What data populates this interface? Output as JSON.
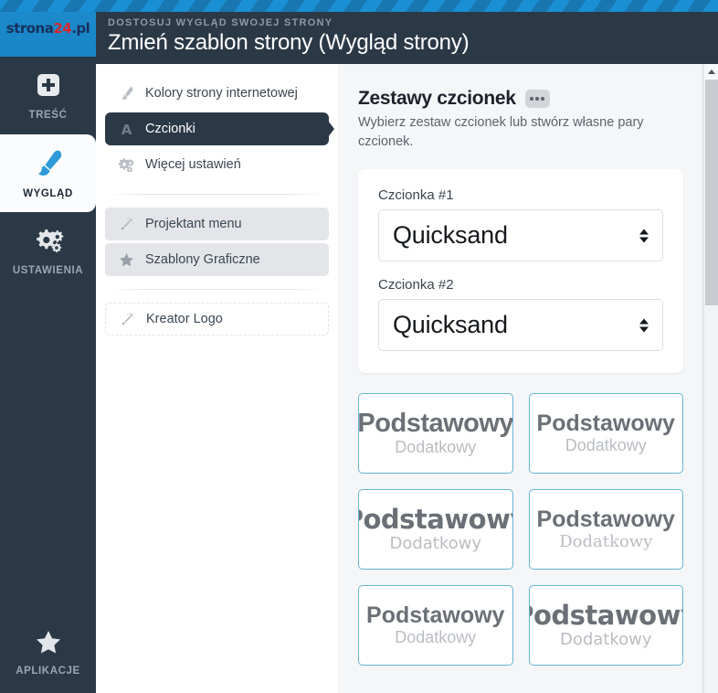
{
  "brand": {
    "logo_part1": "strona",
    "logo_part2": "24",
    "logo_part3": ".pl",
    "accent_blue": "#1b8fd4",
    "dark_navy": "#2b3947",
    "logo_red": "#d8262c"
  },
  "header": {
    "kicker": "DOSTOSUJ WYGLĄD SWOJEJ STRONY",
    "title": "Zmień szablon strony (Wygląd strony)"
  },
  "rail": {
    "items": [
      {
        "label": "TREŚĆ",
        "icon": "plus-square-icon",
        "active": false
      },
      {
        "label": "WYGLĄD",
        "icon": "paintbrush-icon",
        "active": true
      },
      {
        "label": "USTAWIENIA",
        "icon": "gears-icon",
        "active": false
      }
    ],
    "bottom": {
      "label": "APLIKACJE",
      "icon": "star-icon"
    }
  },
  "submenu": {
    "group1": [
      {
        "label": "Kolory strony internetowej",
        "icon": "paintbrush-icon",
        "state": "normal"
      },
      {
        "label": "Czcionki",
        "icon": "letter-a-icon",
        "state": "active"
      },
      {
        "label": "Więcej ustawień",
        "icon": "gears-icon",
        "state": "normal"
      }
    ],
    "group2": [
      {
        "label": "Projektant menu",
        "icon": "magic-wand-icon",
        "state": "soft"
      },
      {
        "label": "Szablony Graficzne",
        "icon": "star-icon",
        "state": "soft"
      }
    ],
    "group3": [
      {
        "label": "Kreator Logo",
        "icon": "magic-wand-icon",
        "state": "outline"
      }
    ]
  },
  "main": {
    "section_title": "Zestawy czcionek",
    "section_badge": "more-options-badge",
    "section_subtitle": "Wybierz zestaw czcionek lub stwórz własne pary czcionek.",
    "picker": {
      "field1_label": "Czcionka #1",
      "field1_value": "Quicksand",
      "field2_label": "Czcionka #2",
      "field2_value": "Quicksand"
    },
    "preview_cards": [
      {
        "primary": "Podstawowy",
        "secondary": "Dodatkowy",
        "style": "f-sans",
        "wide": true
      },
      {
        "primary": "Podstawowy",
        "secondary": "Dodatkowy",
        "style": "f-sans",
        "wide": false
      },
      {
        "primary": "Podstawowy",
        "secondary": "Dodatkowy",
        "style": "f-dejavu",
        "wide": true
      },
      {
        "primary": "Podstawowy",
        "secondary": "Dodatkowy",
        "style": "f-serif",
        "wide": false
      },
      {
        "primary": "Podstawowy",
        "secondary": "Dodatkowy",
        "style": "f-sans",
        "wide": false
      },
      {
        "primary": "Podstawowy",
        "secondary": "Dodatkowy",
        "style": "f-dejavu",
        "wide": true
      }
    ]
  },
  "scrollbar": {
    "up_arrow": "chevron-up-icon",
    "thumb": "scroll-thumb"
  }
}
